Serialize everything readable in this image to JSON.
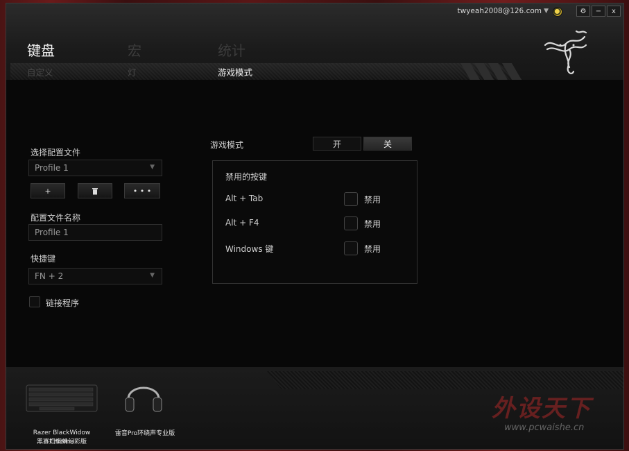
{
  "window": {
    "user_email": "twyeah2008@126.com",
    "settings_icon": "gear-icon",
    "minimize_label": "−",
    "close_label": "x"
  },
  "main_tabs": [
    {
      "label": "键盘",
      "active": true
    },
    {
      "label": "宏",
      "active": false
    },
    {
      "label": "统计",
      "active": false
    }
  ],
  "sub_tabs": [
    {
      "label": "自定义",
      "active": false
    },
    {
      "label": "灯",
      "active": false
    },
    {
      "label": "游戏模式",
      "active": true
    }
  ],
  "profile": {
    "select_label": "选择配置文件",
    "selected": "Profile 1",
    "add_label": "+",
    "delete_icon": "trash-icon",
    "more_label": "• • •",
    "name_label": "配置文件名称",
    "name_value": "Profile 1",
    "hotkey_label": "快捷键",
    "hotkey_value": "FN + 2",
    "link_program_label": "链接程序"
  },
  "game_mode": {
    "label": "游戏模式",
    "on_label": "开",
    "off_label": "关",
    "state": "off",
    "panel_title": "禁用的按键",
    "keys": [
      {
        "name": "Alt + Tab",
        "disable_label": "禁用",
        "checked": false
      },
      {
        "name": "Alt + F4",
        "disable_label": "禁用",
        "checked": false
      },
      {
        "name": "Windows 键",
        "disable_label": "禁用",
        "checked": false
      }
    ]
  },
  "devices": [
    {
      "line1": "Razer BlackWidow Chroma",
      "line2": "黑寡妇蜘蛛幻彩版",
      "icon": "keyboard-icon"
    },
    {
      "line1": "雷音Pro环绕声专业版",
      "line2": "",
      "icon": "headset-icon"
    }
  ],
  "watermark": {
    "cn": "外设天下",
    "url": "www.pcwaishe.cn"
  },
  "colors": {
    "accent_green": "#44d62c",
    "background": "#0a0a0a",
    "watermark_red": "#aa2828"
  }
}
